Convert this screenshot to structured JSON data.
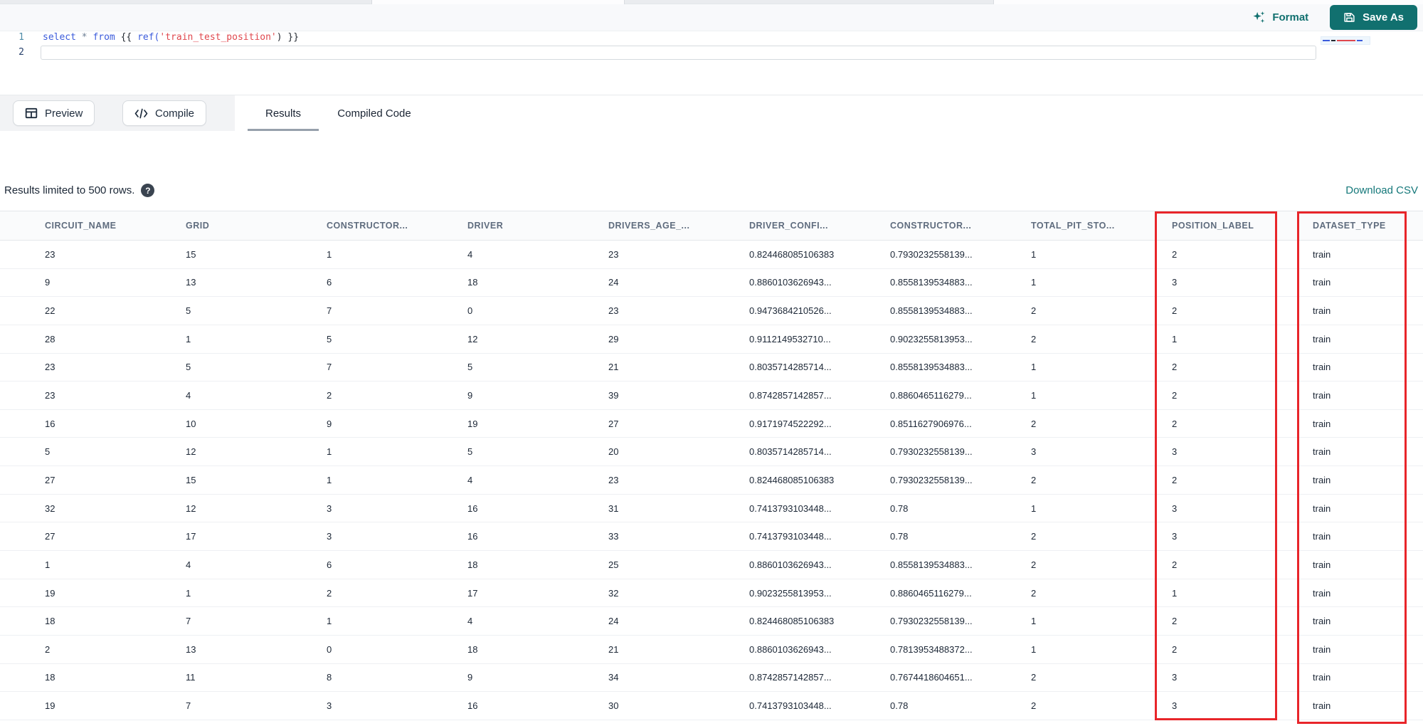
{
  "action_bar": {
    "format_label": "Format",
    "save_as_label": "Save As"
  },
  "editor": {
    "line_numbers": [
      "1",
      "2"
    ],
    "line1_text": "select * from {{ ref('train_test_position') }}",
    "line1_tokens": [
      {
        "type": "keyword",
        "text": "select"
      },
      {
        "type": "operator",
        "text": " * "
      },
      {
        "type": "keyword",
        "text": "from"
      },
      {
        "type": "brace",
        "text": " {{ "
      },
      {
        "type": "function",
        "text": "ref("
      },
      {
        "type": "string",
        "text": "'train_test_position'"
      },
      {
        "type": "brace",
        "text": ") }}"
      }
    ]
  },
  "toolbar": {
    "preview_label": "Preview",
    "compile_label": "Compile"
  },
  "tabs": [
    {
      "label": "Results",
      "active": true
    },
    {
      "label": "Compiled Code",
      "active": false
    }
  ],
  "results_info": {
    "limit_text": "Results limited to 500 rows.",
    "help_glyph": "?",
    "download_csv_label": "Download CSV"
  },
  "table": {
    "columns": [
      "CIRCUIT_NAME",
      "GRID",
      "CONSTRUCTOR...",
      "DRIVER",
      "DRIVERS_AGE_...",
      "DRIVER_CONFI...",
      "CONSTRUCTOR...",
      "TOTAL_PIT_STO...",
      "POSITION_LABEL",
      "DATASET_TYPE"
    ],
    "rows": [
      [
        "23",
        "15",
        "1",
        "4",
        "23",
        "0.824468085106383",
        "0.7930232558139...",
        "1",
        "2",
        "train"
      ],
      [
        "9",
        "13",
        "6",
        "18",
        "24",
        "0.8860103626943...",
        "0.8558139534883...",
        "1",
        "3",
        "train"
      ],
      [
        "22",
        "5",
        "7",
        "0",
        "23",
        "0.9473684210526...",
        "0.8558139534883...",
        "2",
        "2",
        "train"
      ],
      [
        "28",
        "1",
        "5",
        "12",
        "29",
        "0.9112149532710...",
        "0.9023255813953...",
        "2",
        "1",
        "train"
      ],
      [
        "23",
        "5",
        "7",
        "5",
        "21",
        "0.8035714285714...",
        "0.8558139534883...",
        "1",
        "2",
        "train"
      ],
      [
        "23",
        "4",
        "2",
        "9",
        "39",
        "0.8742857142857...",
        "0.8860465116279...",
        "1",
        "2",
        "train"
      ],
      [
        "16",
        "10",
        "9",
        "19",
        "27",
        "0.9171974522292...",
        "0.8511627906976...",
        "2",
        "2",
        "train"
      ],
      [
        "5",
        "12",
        "1",
        "5",
        "20",
        "0.8035714285714...",
        "0.7930232558139...",
        "3",
        "3",
        "train"
      ],
      [
        "27",
        "15",
        "1",
        "4",
        "23",
        "0.824468085106383",
        "0.7930232558139...",
        "2",
        "2",
        "train"
      ],
      [
        "32",
        "12",
        "3",
        "16",
        "31",
        "0.7413793103448...",
        "0.78",
        "1",
        "3",
        "train"
      ],
      [
        "27",
        "17",
        "3",
        "16",
        "33",
        "0.7413793103448...",
        "0.78",
        "2",
        "3",
        "train"
      ],
      [
        "1",
        "4",
        "6",
        "18",
        "25",
        "0.8860103626943...",
        "0.8558139534883...",
        "2",
        "2",
        "train"
      ],
      [
        "19",
        "1",
        "2",
        "17",
        "32",
        "0.9023255813953...",
        "0.8860465116279...",
        "2",
        "1",
        "train"
      ],
      [
        "18",
        "7",
        "1",
        "4",
        "24",
        "0.824468085106383",
        "0.7930232558139...",
        "1",
        "2",
        "train"
      ],
      [
        "2",
        "13",
        "0",
        "18",
        "21",
        "0.8860103626943...",
        "0.7813953488372...",
        "1",
        "2",
        "train"
      ],
      [
        "18",
        "11",
        "8",
        "9",
        "34",
        "0.8742857142857...",
        "0.7674418604651...",
        "2",
        "3",
        "train"
      ],
      [
        "19",
        "7",
        "3",
        "16",
        "30",
        "0.7413793103448...",
        "0.78",
        "2",
        "3",
        "train"
      ]
    ]
  },
  "annotations": {
    "highlighted_columns": [
      "POSITION_LABEL",
      "DATASET_TYPE"
    ],
    "highlight_color": "#e8252a"
  },
  "colors": {
    "accent_teal": "#11706f",
    "download_link_teal": "#15787a",
    "keyword_blue": "#3b5bdb",
    "string_red": "#e0484e",
    "header_text": "#5f6c7e"
  }
}
